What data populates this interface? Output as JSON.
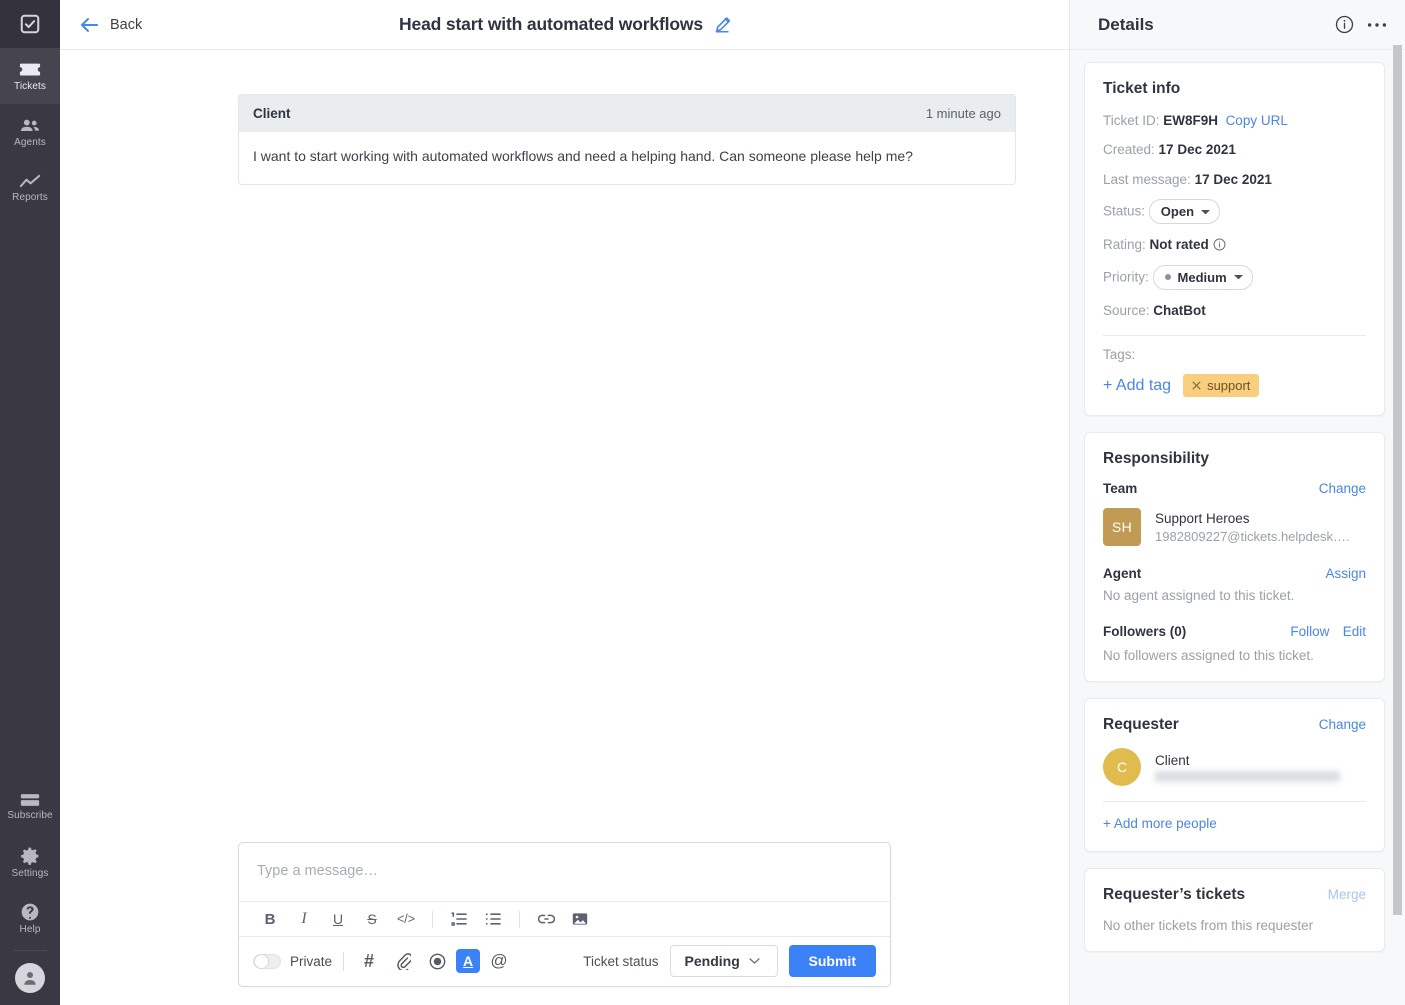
{
  "sidebar": {
    "logo_icon": "checkbox-logo-icon",
    "items": [
      {
        "label": "Tickets",
        "icon": "ticket-icon",
        "active": true
      },
      {
        "label": "Agents",
        "icon": "people-icon",
        "active": false
      },
      {
        "label": "Reports",
        "icon": "line-chart-icon",
        "active": false
      }
    ],
    "bottom_items": [
      {
        "label": "Subscribe",
        "icon": "credit-card-icon"
      },
      {
        "label": "Settings",
        "icon": "gear-icon"
      },
      {
        "label": "Help",
        "icon": "question-circle-icon"
      }
    ],
    "avatar_icon": "user-avatar-icon"
  },
  "topbar": {
    "back_label": "Back",
    "back_icon": "arrow-left-icon",
    "title": "Head start with automated workflows",
    "edit_icon": "pencil-edit-icon"
  },
  "thread": {
    "message": {
      "author": "Client",
      "time": "1 minute ago",
      "body": "I want to start working with automated workflows and need a helping hand. Can someone please help me?"
    }
  },
  "composer": {
    "placeholder": "Type a message…",
    "format_buttons": [
      {
        "name": "bold-button",
        "label": "B"
      },
      {
        "name": "italic-button",
        "label": "I"
      },
      {
        "name": "underline-button",
        "label": "U"
      },
      {
        "name": "strikethrough-button",
        "label": "S"
      },
      {
        "name": "code-button",
        "label": "</>"
      },
      {
        "name": "ordered-list-button",
        "label": ""
      },
      {
        "name": "bullet-list-button",
        "label": ""
      },
      {
        "name": "link-button",
        "label": ""
      },
      {
        "name": "image-button",
        "label": ""
      }
    ],
    "private_label": "Private",
    "private_on": false,
    "action_buttons": [
      {
        "name": "canned-response-button",
        "label": "#"
      },
      {
        "name": "attachment-button",
        "label": ""
      },
      {
        "name": "record-button",
        "label": ""
      },
      {
        "name": "text-format-button",
        "label": "A"
      },
      {
        "name": "mention-button",
        "label": "@"
      }
    ],
    "ticket_status_label": "Ticket status",
    "ticket_status_value": "Pending",
    "submit_label": "Submit"
  },
  "details": {
    "title": "Details",
    "info_icon": "info-circle-icon",
    "more_icon": "ellipsis-icon",
    "ticket_info": {
      "title": "Ticket info",
      "ticket_id_label": "Ticket ID:",
      "ticket_id": "EW8F9H",
      "copy_url": "Copy URL",
      "created_label": "Created:",
      "created": "17 Dec 2021",
      "last_message_label": "Last message:",
      "last_message": "17 Dec 2021",
      "status_label": "Status:",
      "status": "Open",
      "rating_label": "Rating:",
      "rating": "Not rated",
      "priority_label": "Priority:",
      "priority": "Medium",
      "source_label": "Source:",
      "source": "ChatBot",
      "tags_label": "Tags:",
      "add_tag": "+ Add tag",
      "tags": [
        {
          "label": "support",
          "color": "#f9ce7f"
        }
      ]
    },
    "responsibility": {
      "title": "Responsibility",
      "team_label": "Team",
      "team_change": "Change",
      "team_initials": "SH",
      "team_name": "Support Heroes",
      "team_email": "1982809227@tickets.helpdesk….",
      "agent_label": "Agent",
      "agent_assign": "Assign",
      "agent_empty": "No agent assigned to this ticket.",
      "followers_label": "Followers (0)",
      "followers_follow": "Follow",
      "followers_edit": "Edit",
      "followers_empty": "No followers assigned to this ticket."
    },
    "requester": {
      "title": "Requester",
      "change": "Change",
      "initial": "C",
      "name": "Client",
      "email": "",
      "add_people": "+ Add more people"
    },
    "requester_tickets": {
      "title": "Requester’s tickets",
      "merge": "Merge",
      "empty": "No other tickets from this requester"
    }
  },
  "colors": {
    "accent": "#3b82f6",
    "link": "#4a86e8",
    "rail_bg": "#3a3843",
    "tag": "#f9ce7f",
    "team_avatar": "#c19a54",
    "requester_avatar": "#e0bc4e"
  }
}
